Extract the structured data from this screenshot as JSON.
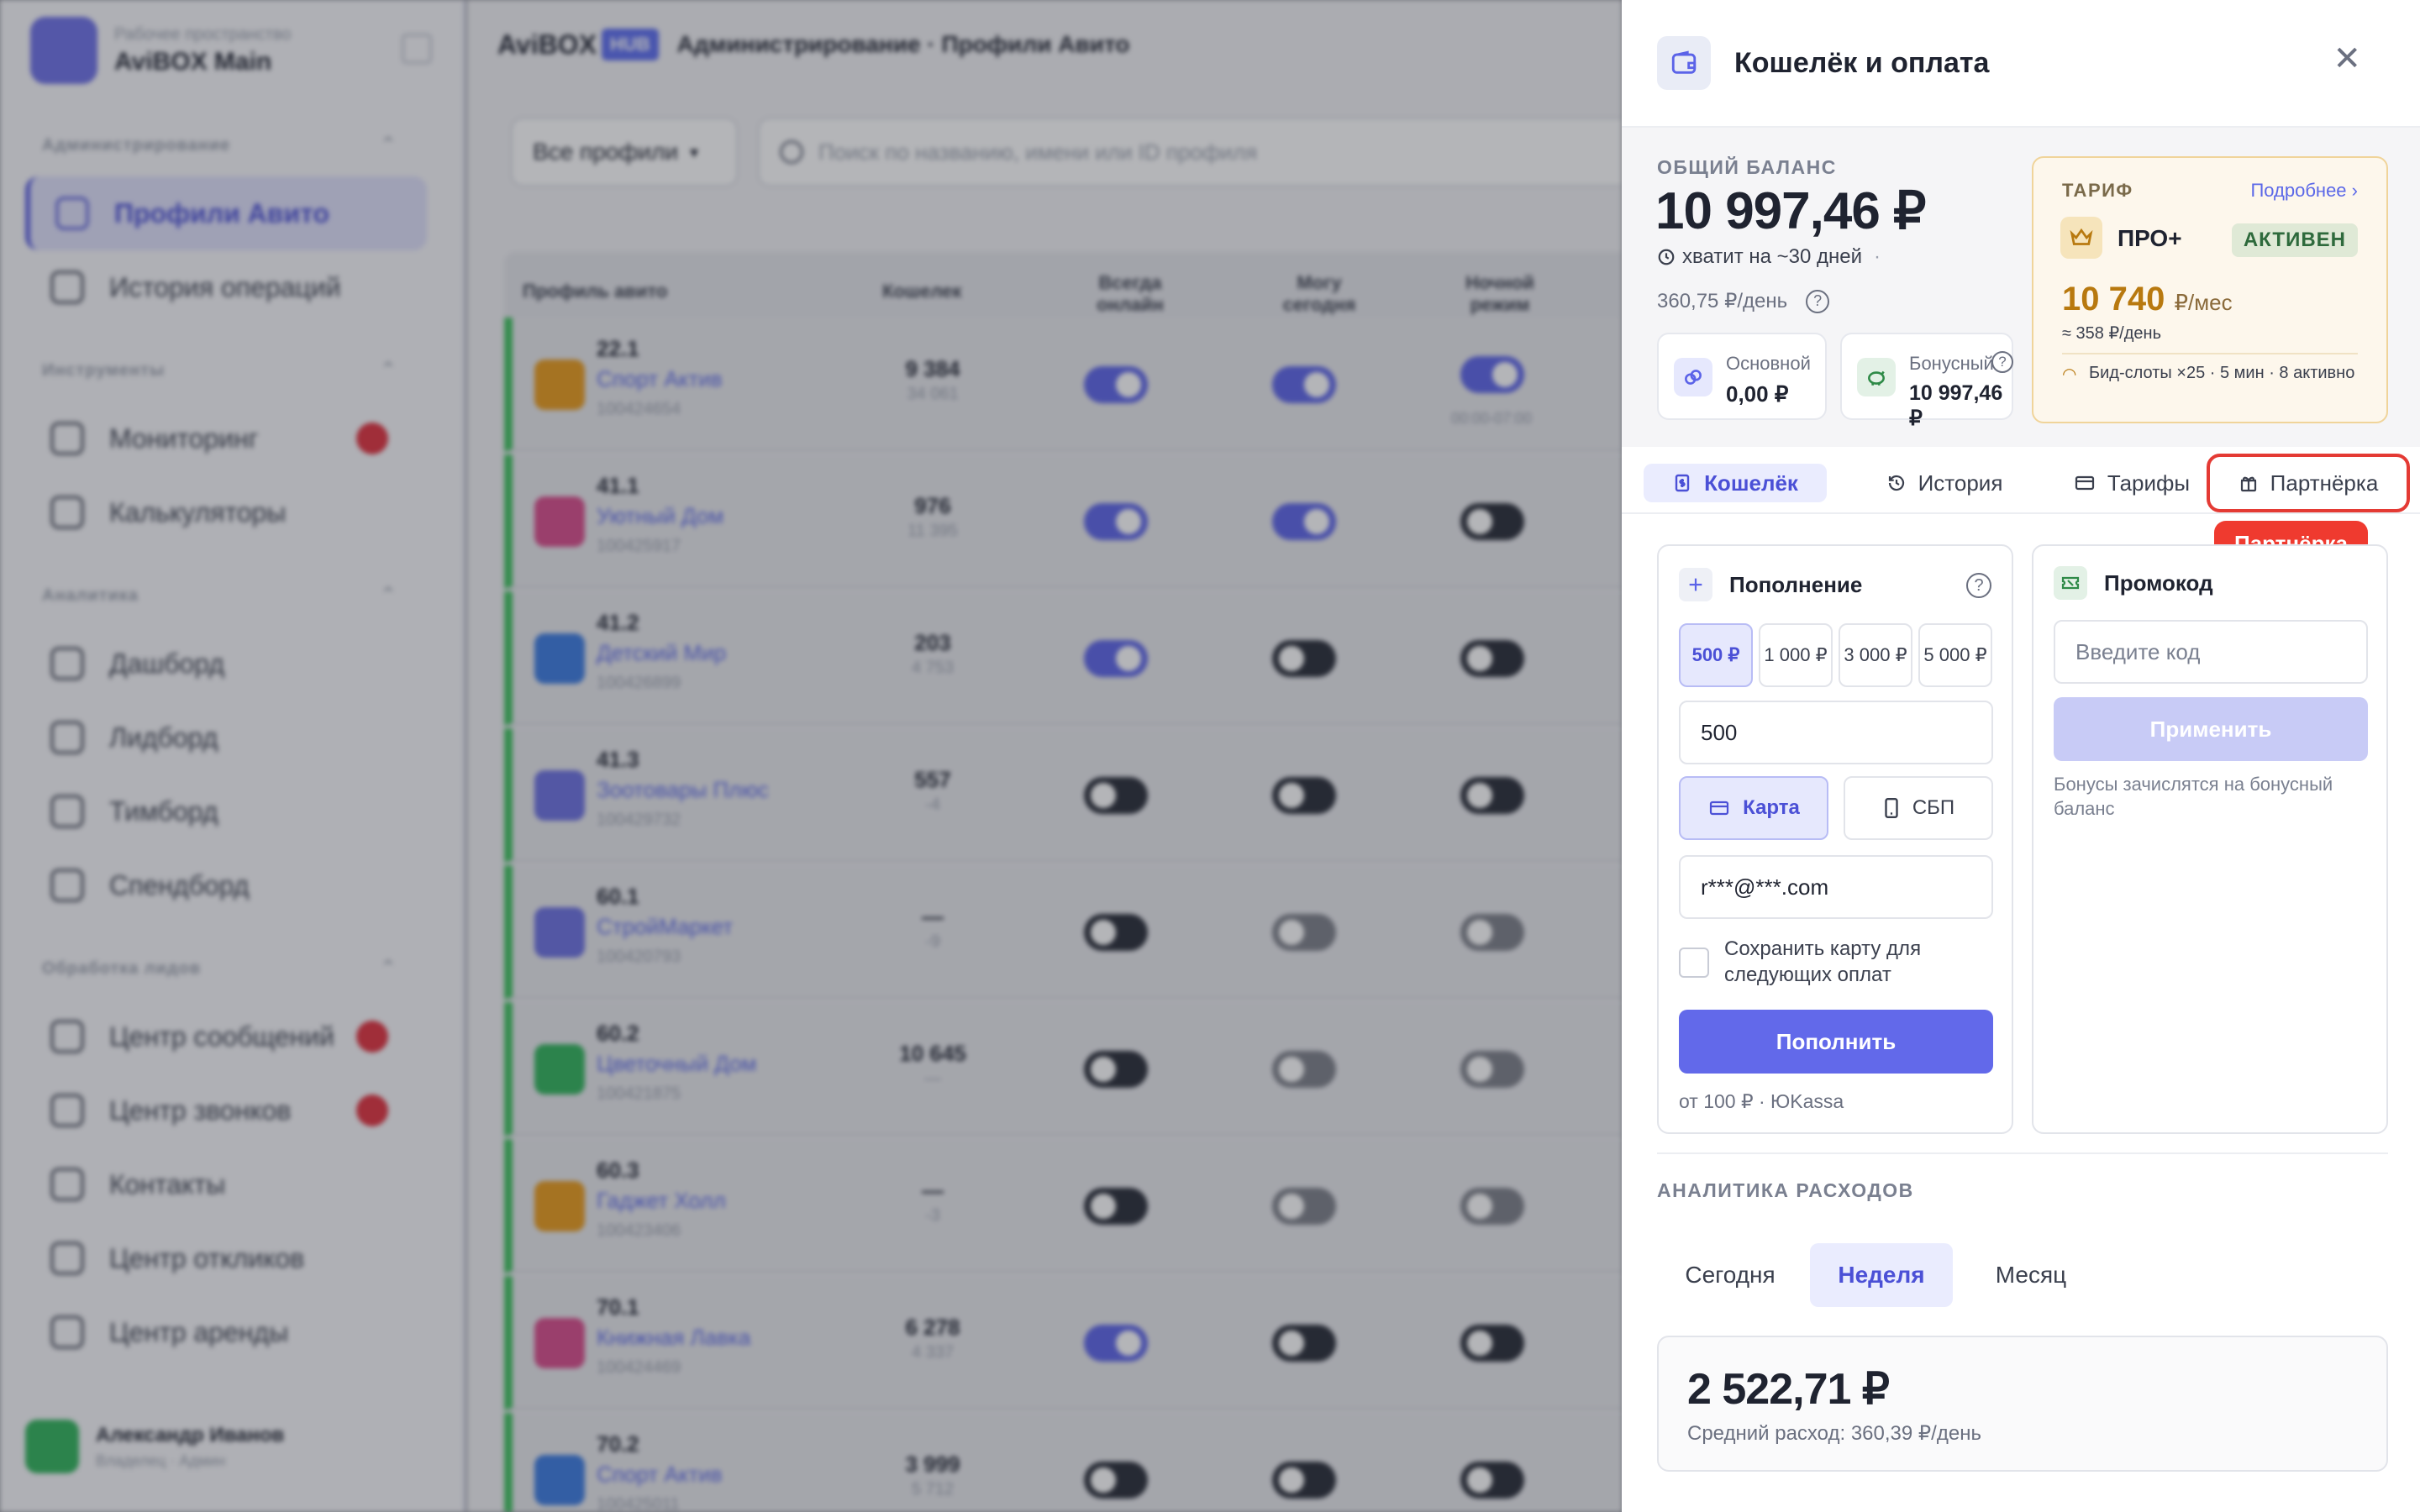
{
  "workspace": {
    "label": "Рабочее пространство",
    "name": "AviBOX Main"
  },
  "sidebar": {
    "sections": [
      {
        "title": "Администрирование",
        "items": [
          {
            "label": "Профили Авито"
          },
          {
            "label": "История операций"
          }
        ]
      },
      {
        "title": "Инструменты",
        "items": [
          {
            "label": "Мониторинг"
          },
          {
            "label": "Калькуляторы"
          }
        ]
      },
      {
        "title": "Аналитика",
        "items": [
          {
            "label": "Дашборд"
          },
          {
            "label": "Лидборд"
          },
          {
            "label": "Тимборд"
          },
          {
            "label": "Спендборд"
          }
        ]
      },
      {
        "title": "Обработка лидов",
        "items": [
          {
            "label": "Центр сообщений"
          },
          {
            "label": "Центр звонков"
          },
          {
            "label": "Контакты"
          },
          {
            "label": "Центр откликов"
          },
          {
            "label": "Центр аренды"
          }
        ]
      }
    ],
    "user": {
      "name": "Александр Иванов",
      "role": "Владелец · Админ"
    }
  },
  "header": {
    "brand": "AviBOX",
    "brand_badge": "HUB",
    "breadcrumb": "Администрирование · Профили Авито"
  },
  "toolbar": {
    "filter_label": "Все профили",
    "search_placeholder": "Поиск по названию, имени или ID профиля"
  },
  "table": {
    "headers": [
      "Профиль авито",
      "Кошелек",
      "Всегда онлайн",
      "Могу сегодня",
      "Ночной режим"
    ],
    "rows": [
      {
        "num": "22.1",
        "name": "Спорт Актив",
        "id": "100424654",
        "w1": "9 384",
        "w2": "34 061",
        "color": "#e89a1a"
      },
      {
        "num": "41.1",
        "name": "Уютный Дом",
        "id": "100425917",
        "w1": "976",
        "w2": "11 395",
        "color": "#d84a8a"
      },
      {
        "num": "41.2",
        "name": "Детский Мир",
        "id": "100426899",
        "w1": "203",
        "w2": "4 753",
        "color": "#3a7ae0"
      },
      {
        "num": "41.3",
        "name": "Зоотовары Плюс",
        "id": "100429732",
        "w1": "557",
        "w2": "-4",
        "color": "#6a6fe0"
      },
      {
        "num": "60.1",
        "name": "СтройМаркет",
        "id": "100420793",
        "w1": "—",
        "w2": "-9",
        "color": "#6a6fe0"
      },
      {
        "num": "60.2",
        "name": "Цветочный Дом",
        "id": "100421875",
        "w1": "10 645",
        "w2": "—",
        "color": "#2fb35a"
      },
      {
        "num": "60.3",
        "name": "Гаджет Холл",
        "id": "100423406",
        "w1": "—",
        "w2": "-3",
        "color": "#e89a1a"
      },
      {
        "num": "70.1",
        "name": "Книжная Лавка",
        "id": "100424469",
        "w1": "6 278",
        "w2": "4 337",
        "color": "#d84a8a"
      },
      {
        "num": "70.2",
        "name": "Спорт Актив",
        "id": "100425011",
        "w1": "3 999",
        "w2": "5 712",
        "color": "#3a7ae0"
      }
    ],
    "night_time": "00:00-07:00"
  },
  "panel": {
    "title": "Кошелёк и оплата",
    "balance": {
      "label": "ОБЩИЙ БАЛАНС",
      "value": "10 997,46 ₽",
      "enough": "хватит на ~30 дней",
      "enough_sep": "·",
      "per_day": "360,75 ₽/день",
      "main_label": "Основной",
      "main_value": "0,00 ₽",
      "bonus_label": "Бонусный",
      "bonus_value": "10 997,46 ₽"
    },
    "tariff": {
      "label": "ТАРИФ",
      "more": "Подробнее",
      "name": "ПРО+",
      "status": "АКТИВЕН",
      "price": "10 740",
      "price_unit": "₽/мес",
      "per_day": "≈ 358 ₽/день",
      "features": "Бид-слоты ×25 · 5 мин · 8 активно"
    },
    "tabs": [
      {
        "label": "Кошелёк"
      },
      {
        "label": "История"
      },
      {
        "label": "Тарифы"
      },
      {
        "label": "Партнёрка"
      }
    ],
    "tooltip": "Партнёрка",
    "topup": {
      "title": "Пополнение",
      "amounts": [
        "500 ₽",
        "1 000 ₽",
        "3 000 ₽",
        "5 000 ₽"
      ],
      "amount_value": "500",
      "method_card": "Карта",
      "method_sbp": "СБП",
      "email": "r***@***.com",
      "save_card": "Сохранить карту для следующих оплат",
      "submit": "Пополнить",
      "note": "от 100 ₽ · ЮKassa"
    },
    "promo": {
      "title": "Промокод",
      "placeholder": "Введите код",
      "apply": "Применить",
      "note": "Бонусы зачислятся на бонусный баланс"
    },
    "analytics": {
      "title": "АНАЛИТИКА РАСХОДОВ",
      "periods": [
        "Сегодня",
        "Неделя",
        "Месяц"
      ],
      "selected": "Неделя",
      "total": "2 522,71 ₽",
      "avg": "Средний расход: 360,39 ₽/день"
    }
  }
}
